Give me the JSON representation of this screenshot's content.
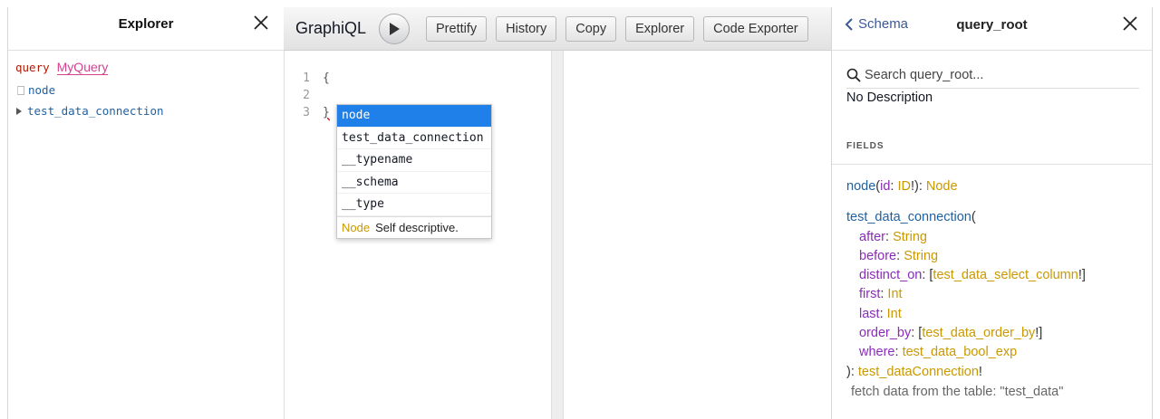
{
  "explorer": {
    "title": "Explorer",
    "query_keyword": "query",
    "query_name": "MyQuery",
    "tree": [
      {
        "label": "node"
      },
      {
        "label": "test_data_connection"
      }
    ]
  },
  "toolbar": {
    "brand": "GraphiQL",
    "buttons": [
      "Prettify",
      "History",
      "Copy",
      "Explorer",
      "Code Exporter"
    ]
  },
  "editor": {
    "line_numbers": [
      "1",
      "2",
      "3"
    ],
    "lines": [
      "{",
      "",
      "}"
    ]
  },
  "autocomplete": {
    "items": [
      "node",
      "test_data_connection",
      "__typename",
      "__schema",
      "__type"
    ],
    "info_type": "Node",
    "info_text": "Self descriptive."
  },
  "docs": {
    "back_label": "Schema",
    "title": "query_root",
    "search_placeholder": "Search query_root...",
    "no_description": "No Description",
    "fields_title": "FIELDS",
    "field1": {
      "name": "node",
      "arg": "id",
      "type": "ID",
      "bang": "!",
      "return_type": "Node"
    },
    "field2": {
      "name": "test_data_connection",
      "args": [
        {
          "name": "after",
          "type": "String"
        },
        {
          "name": "before",
          "type": "String"
        },
        {
          "name": "distinct_on",
          "type": "test_data_select_column",
          "list": true
        },
        {
          "name": "first",
          "type": "Int"
        },
        {
          "name": "last",
          "type": "Int"
        },
        {
          "name": "order_by",
          "type": "test_data_order_by",
          "list": true
        },
        {
          "name": "where",
          "type": "test_data_bool_exp"
        }
      ],
      "return_type": "test_dataConnection",
      "description": "fetch data from the table: \"test_data\""
    }
  },
  "colors": {
    "accent": "#1e80e8",
    "field": "#1f61a0",
    "arg": "#8b2bb9",
    "type": "#ca9800"
  }
}
